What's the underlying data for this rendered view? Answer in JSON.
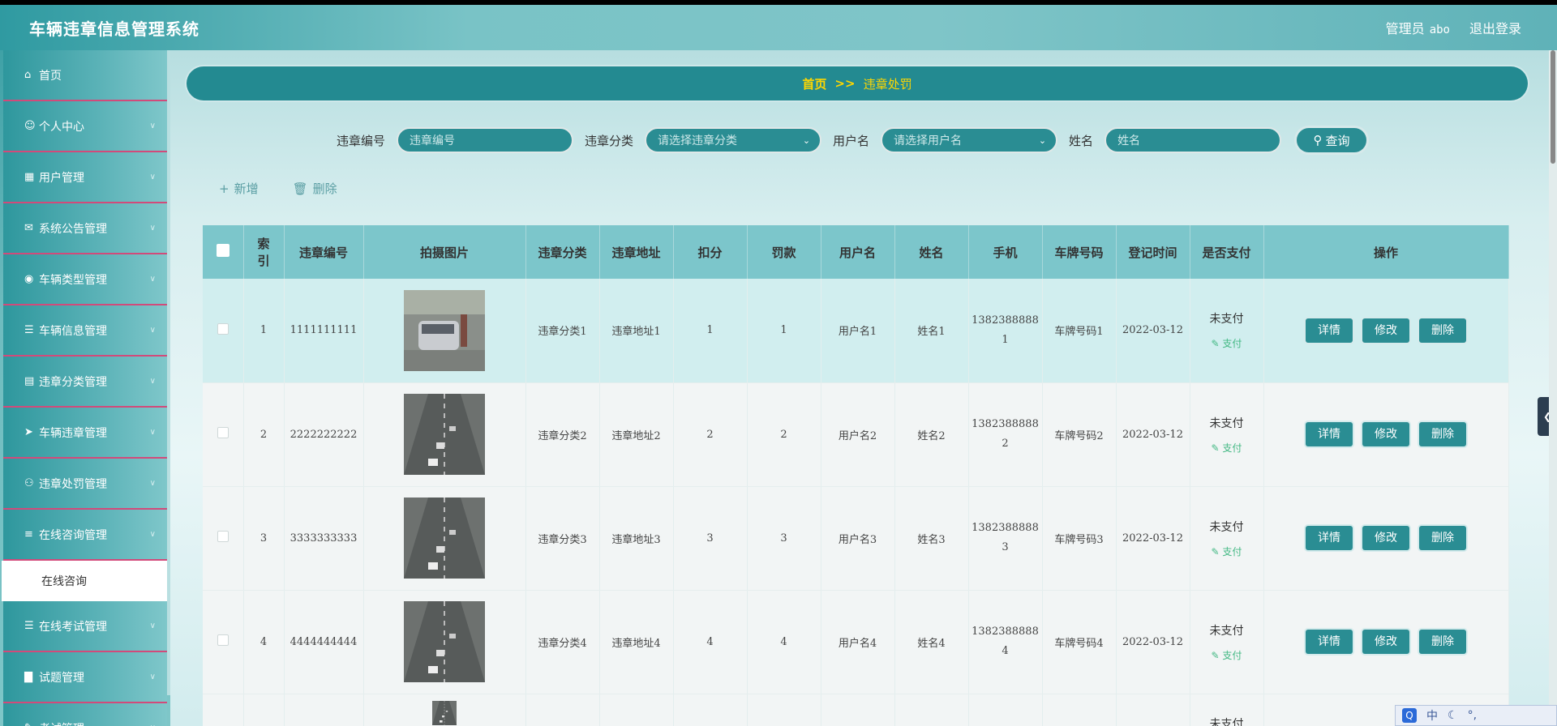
{
  "header": {
    "app_title": "车辆违章信息管理系统",
    "role": "管理员",
    "username": "abo",
    "logout": "退出登录"
  },
  "sidebar": {
    "items": [
      {
        "label": "首页",
        "icon": "home-icon",
        "has_arrow": false
      },
      {
        "label": "个人中心",
        "icon": "user-icon",
        "has_arrow": true
      },
      {
        "label": "用户管理",
        "icon": "grid-icon",
        "has_arrow": true
      },
      {
        "label": "系统公告管理",
        "icon": "megaphone-icon",
        "has_arrow": true
      },
      {
        "label": "车辆类型管理",
        "icon": "location-icon",
        "has_arrow": true
      },
      {
        "label": "车辆信息管理",
        "icon": "document-icon",
        "has_arrow": true
      },
      {
        "label": "违章分类管理",
        "icon": "clipboard-icon",
        "has_arrow": true
      },
      {
        "label": "车辆违章管理",
        "icon": "send-icon",
        "has_arrow": true
      },
      {
        "label": "违章处罚管理",
        "icon": "person-icon",
        "has_arrow": true
      },
      {
        "label": "在线咨询管理",
        "icon": "sliders-icon",
        "has_arrow": true
      }
    ],
    "active_sub": "在线咨询",
    "items_after": [
      {
        "label": "在线考试管理",
        "icon": "menu-icon",
        "has_arrow": true
      },
      {
        "label": "试题管理",
        "icon": "bar-chart-icon",
        "has_arrow": true
      },
      {
        "label": "考试管理",
        "icon": "exam-icon",
        "has_arrow": true
      }
    ]
  },
  "breadcrumb": {
    "home": "首页",
    "separator": ">>",
    "current": "违章处罚"
  },
  "search": {
    "fields": [
      {
        "label": "违章编号",
        "placeholder": "违章编号",
        "type": "input"
      },
      {
        "label": "违章分类",
        "placeholder": "请选择违章分类",
        "type": "select"
      },
      {
        "label": "用户名",
        "placeholder": "请选择用户名",
        "type": "select"
      },
      {
        "label": "姓名",
        "placeholder": "姓名",
        "type": "input"
      }
    ],
    "button": "查询"
  },
  "actions": {
    "add": "新增",
    "delete": "删除"
  },
  "table": {
    "headers": [
      "索引",
      "违章编号",
      "拍摄图片",
      "违章分类",
      "违章地址",
      "扣分",
      "罚款",
      "用户名",
      "姓名",
      "手机",
      "车牌号码",
      "登记时间",
      "是否支付",
      "操作"
    ],
    "rows": [
      {
        "index": "1",
        "code": "1111111111",
        "category": "违章分类1",
        "address": "违章地址1",
        "points": "1",
        "fine": "1",
        "username": "用户名1",
        "name": "姓名1",
        "phone_a": "1382388888",
        "phone_b": "1",
        "plate": "车牌号码1",
        "date": "2022-03-12",
        "paid": "未支付",
        "pay": "支付"
      },
      {
        "index": "2",
        "code": "2222222222",
        "category": "违章分类2",
        "address": "违章地址2",
        "points": "2",
        "fine": "2",
        "username": "用户名2",
        "name": "姓名2",
        "phone_a": "1382388888",
        "phone_b": "2",
        "plate": "车牌号码2",
        "date": "2022-03-12",
        "paid": "未支付",
        "pay": "支付"
      },
      {
        "index": "3",
        "code": "3333333333",
        "category": "违章分类3",
        "address": "违章地址3",
        "points": "3",
        "fine": "3",
        "username": "用户名3",
        "name": "姓名3",
        "phone_a": "1382388888",
        "phone_b": "3",
        "plate": "车牌号码3",
        "date": "2022-03-12",
        "paid": "未支付",
        "pay": "支付"
      },
      {
        "index": "4",
        "code": "4444444444",
        "category": "违章分类4",
        "address": "违章地址4",
        "points": "4",
        "fine": "4",
        "username": "用户名4",
        "name": "姓名4",
        "phone_a": "1382388888",
        "phone_b": "4",
        "plate": "车牌号码4",
        "date": "2022-03-12",
        "paid": "未支付",
        "pay": "支付"
      }
    ],
    "partial_row": {
      "paid": "未支付"
    },
    "op_labels": {
      "detail": "详情",
      "edit": "修改",
      "delete": "删除"
    }
  },
  "ime": {
    "badge": "Q",
    "mode": "中"
  },
  "colors": {
    "accent": "#2a8d93",
    "header_row": "#7cc6cb",
    "breadcrumb_text": "#ffd700",
    "pay_link": "#42b883"
  }
}
